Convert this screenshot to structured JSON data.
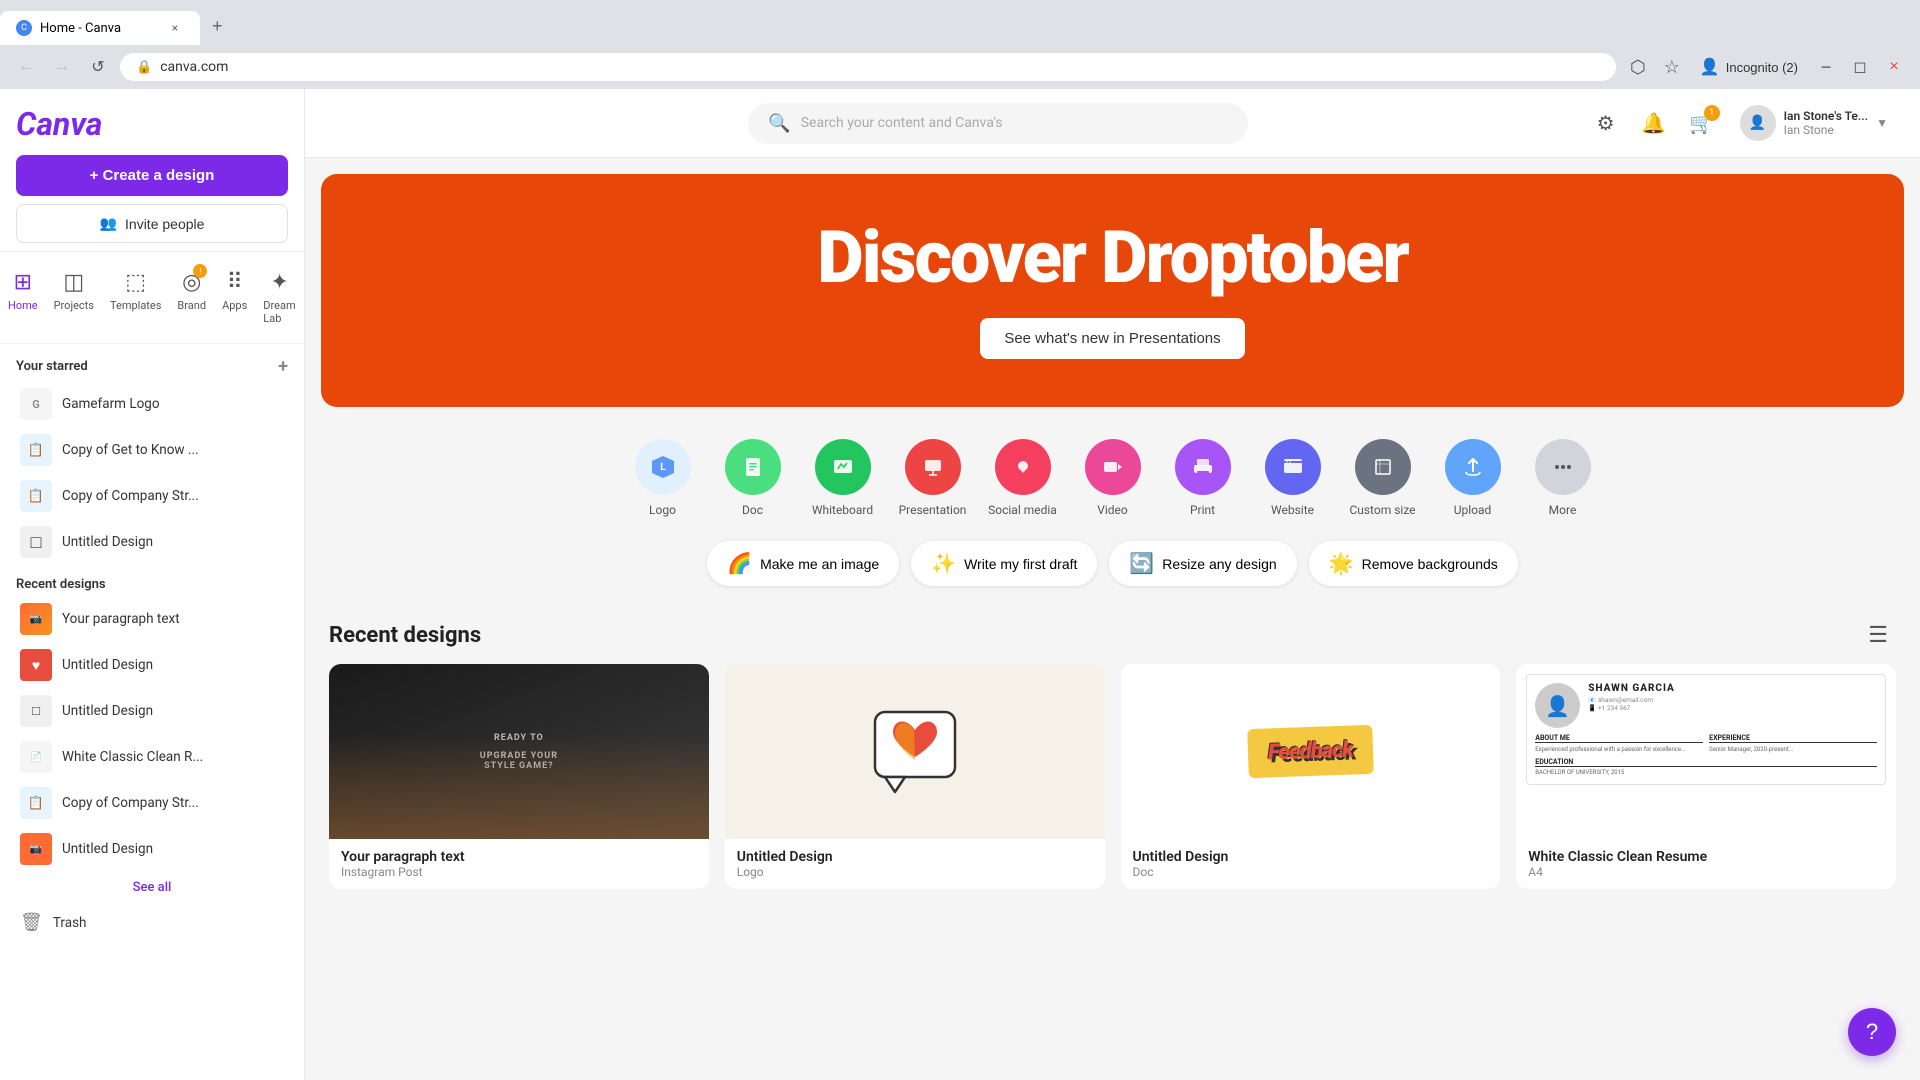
{
  "browser": {
    "tab_title": "Home - Canva",
    "url": "canva.com",
    "tab_close": "×",
    "new_tab": "+",
    "nav_back": "←",
    "nav_forward": "→",
    "nav_reload": "↺",
    "incognito_label": "Incognito (2)"
  },
  "sidebar": {
    "logo": "Canva",
    "create_design_label": "+ Create a design",
    "invite_label": "Invite people",
    "nav_items": [
      {
        "id": "home",
        "icon": "⊞",
        "label": "Home",
        "active": true
      },
      {
        "id": "projects",
        "icon": "◫",
        "label": "Projects",
        "active": false
      },
      {
        "id": "templates",
        "icon": "⬚",
        "label": "Templates",
        "active": false
      },
      {
        "id": "brand",
        "icon": "◎",
        "label": "Brand",
        "active": false,
        "badge": "!"
      },
      {
        "id": "apps",
        "icon": "⠿",
        "label": "Apps",
        "active": false
      },
      {
        "id": "dream-lab",
        "icon": "✦",
        "label": "Dream Lab",
        "active": false
      }
    ],
    "starred_section": "Your starred",
    "starred_items": [
      {
        "name": "Gamefarm Logo",
        "icon_bg": "#f5f5f5"
      },
      {
        "name": "Copy of Get to Know ...",
        "icon_bg": "#e8f4fd"
      },
      {
        "name": "Copy of Company Str...",
        "icon_bg": "#e8f4fd"
      },
      {
        "name": "Untitled Design",
        "icon_bg": "#ffffff"
      }
    ],
    "recent_section": "Recent designs",
    "recent_items": [
      {
        "name": "Your paragraph text",
        "icon_bg": "#ff6b35"
      },
      {
        "name": "Untitled Design",
        "icon_bg": "#e74c3c"
      },
      {
        "name": "Untitled Design",
        "icon_bg": "#ffffff"
      },
      {
        "name": "White Classic Clean R...",
        "icon_bg": "#f5f5f5"
      },
      {
        "name": "Copy of Company Str...",
        "icon_bg": "#e8f4fd"
      },
      {
        "name": "Untitled Design",
        "icon_bg": "#ff6b35"
      }
    ],
    "see_all": "See all",
    "trash_label": "Trash"
  },
  "header": {
    "search_placeholder": "Search your content and Canva's",
    "cart_badge": "1",
    "profile_name": "Ian Stone's Te...",
    "profile_sub": "Ian Stone"
  },
  "hero": {
    "title": "Discover Droptober",
    "cta_label": "See what's new in Presentations"
  },
  "quick_actions": [
    {
      "id": "logo",
      "icon": "⬡",
      "bg": "#e8f4fd",
      "label": "Logo"
    },
    {
      "id": "doc",
      "icon": "📄",
      "bg": "#4ade80",
      "label": "Doc"
    },
    {
      "id": "whiteboard",
      "icon": "🖊",
      "bg": "#22c55e",
      "label": "Whiteboard"
    },
    {
      "id": "presentation",
      "icon": "📊",
      "bg": "#ef4444",
      "label": "Presentation"
    },
    {
      "id": "social-media",
      "icon": "♥",
      "bg": "#f43f5e",
      "label": "Social media"
    },
    {
      "id": "video",
      "icon": "▶",
      "bg": "#ec4899",
      "label": "Video"
    },
    {
      "id": "print",
      "icon": "🖨",
      "bg": "#a855f7",
      "label": "Print"
    },
    {
      "id": "website",
      "icon": "🖥",
      "bg": "#6366f1",
      "label": "Website"
    },
    {
      "id": "custom-size",
      "icon": "⊞",
      "bg": "#6b7280",
      "label": "Custom size"
    },
    {
      "id": "upload",
      "icon": "☁",
      "bg": "#60a5fa",
      "label": "Upload"
    },
    {
      "id": "more",
      "icon": "···",
      "bg": "#d1d5db",
      "label": "More"
    }
  ],
  "ai_prompts": [
    {
      "id": "make-image",
      "icon": "🌈",
      "label": "Make me an image"
    },
    {
      "id": "write-draft",
      "icon": "✨",
      "label": "Write my first draft"
    },
    {
      "id": "resize-design",
      "icon": "🔄",
      "label": "Resize any design"
    },
    {
      "id": "remove-bg",
      "icon": "🌟",
      "label": "Remove backgrounds"
    }
  ],
  "recent_designs": {
    "title": "Recent designs",
    "items": [
      {
        "name": "Your paragraph text",
        "type": "Instagram Post",
        "thumb_style": "orange"
      },
      {
        "name": "Untitled Design",
        "type": "Logo",
        "thumb_style": "heart"
      },
      {
        "name": "Untitled Design",
        "type": "Doc",
        "thumb_style": "feedback"
      },
      {
        "name": "White Classic Clean Resume",
        "type": "A4",
        "thumb_style": "resume"
      }
    ]
  },
  "help_btn": "?"
}
